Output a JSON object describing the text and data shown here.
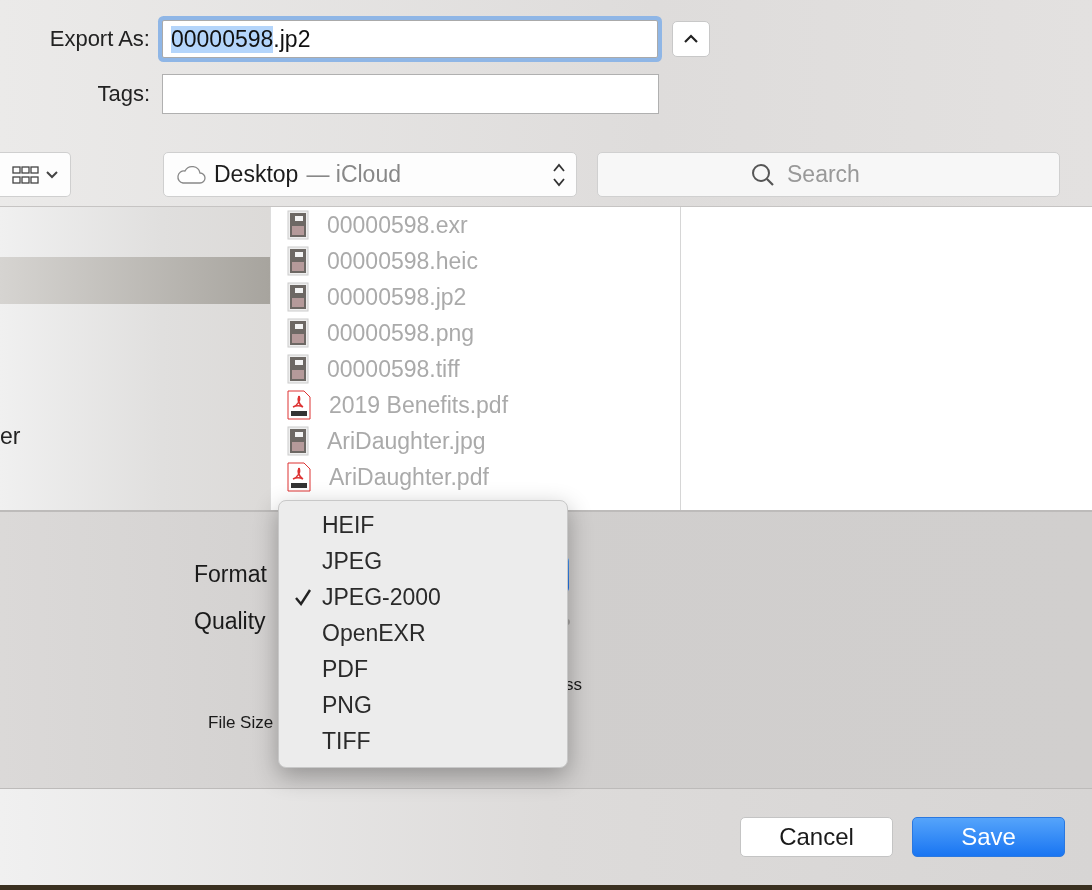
{
  "export_as": {
    "label": "Export As:",
    "selected_text": "00000598",
    "unselected_text": ".jp2"
  },
  "tags": {
    "label": "Tags:"
  },
  "location": {
    "folder": "Desktop",
    "suffix": "— iCloud"
  },
  "search": {
    "placeholder": "Search"
  },
  "sidebar": {
    "items": [
      {
        "selected": true
      },
      {
        "label": "er",
        "selected": false
      }
    ]
  },
  "files": [
    {
      "name": "00000598.exr",
      "kind": "image",
      "disabled": true
    },
    {
      "name": "00000598.heic",
      "kind": "image",
      "disabled": true
    },
    {
      "name": "00000598.jp2",
      "kind": "image",
      "disabled": true
    },
    {
      "name": "00000598.png",
      "kind": "image",
      "disabled": true
    },
    {
      "name": "00000598.tiff",
      "kind": "image",
      "disabled": true
    },
    {
      "name": "2019 Benefits.pdf",
      "kind": "pdf",
      "disabled": true
    },
    {
      "name": "AriDaughter.jpg",
      "kind": "image",
      "disabled": true
    },
    {
      "name": "AriDaughter.pdf",
      "kind": "pdf",
      "disabled": true
    }
  ],
  "options": {
    "format_label": "Format",
    "quality_label": "Quality",
    "quality_hint": "ss",
    "file_size_label": "File Size"
  },
  "format_menu": {
    "items": [
      {
        "label": "HEIF",
        "checked": false
      },
      {
        "label": "JPEG",
        "checked": false
      },
      {
        "label": "JPEG-2000",
        "checked": true
      },
      {
        "label": "OpenEXR",
        "checked": false
      },
      {
        "label": "PDF",
        "checked": false
      },
      {
        "label": "PNG",
        "checked": false
      },
      {
        "label": "TIFF",
        "checked": false
      }
    ]
  },
  "buttons": [
    {
      "label": "Cancel",
      "kind": "secondary"
    },
    {
      "label": "Save",
      "kind": "default"
    }
  ]
}
